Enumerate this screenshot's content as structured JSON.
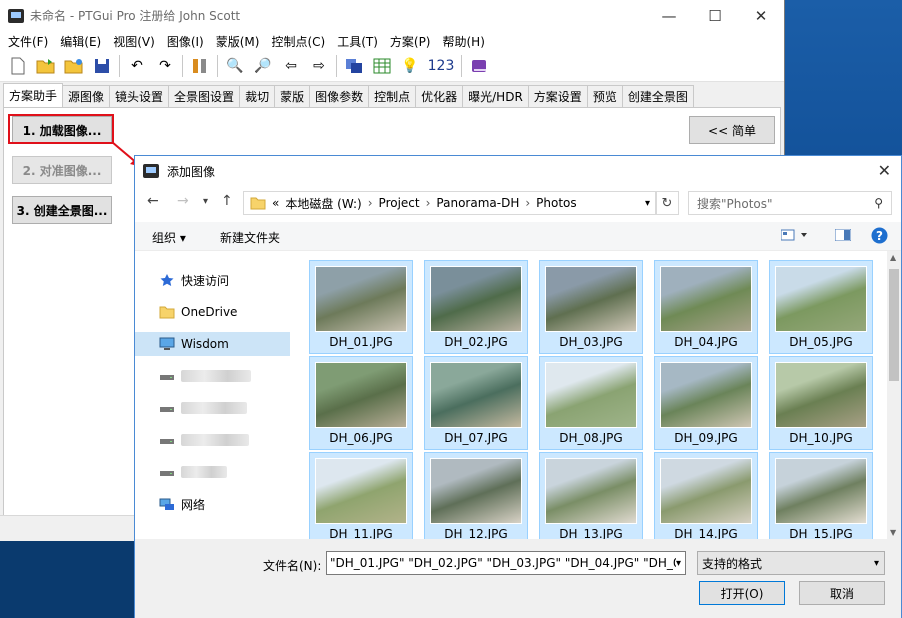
{
  "main_window": {
    "title": "未命名 - PTGui Pro 注册给 John Scott",
    "controls": {
      "minimize": "—",
      "maximize": "☐",
      "close": "✕"
    },
    "menu": [
      "文件(F)",
      "编辑(E)",
      "视图(V)",
      "图像(I)",
      "蒙版(M)",
      "控制点(C)",
      "工具(T)",
      "方案(P)",
      "帮助(H)"
    ],
    "toolbar_counter": "123",
    "tabs": [
      "方案助手",
      "源图像",
      "镜头设置",
      "全景图设置",
      "裁切",
      "蒙版",
      "图像参数",
      "控制点",
      "优化器",
      "曝光/HDR",
      "方案设置",
      "预览",
      "创建全景图"
    ],
    "active_tab": 0,
    "wizard": {
      "load_button": "1. 加载图像...",
      "align_button": "2. 对准图像...",
      "create_button": "3. 创建全景图...",
      "simple_button": "<< 简单"
    }
  },
  "dialog": {
    "title": "添加图像",
    "close": "✕",
    "address": {
      "prefix": "«",
      "parts": [
        "本地磁盘 (W:)",
        "Project",
        "Panorama-DH",
        "Photos"
      ]
    },
    "search_placeholder": "搜索\"Photos\"",
    "commands": {
      "organize": "组织 ▾",
      "new_folder": "新建文件夹"
    },
    "nav_items": [
      {
        "label": "快速访问",
        "icon": "star-icon"
      },
      {
        "label": "OneDrive",
        "icon": "folder-icon"
      },
      {
        "label": "Wisdom",
        "icon": "computer-icon"
      },
      {
        "label": "",
        "icon": "drive-icon"
      },
      {
        "label": "",
        "icon": "drive-icon"
      },
      {
        "label": "",
        "icon": "drive-icon"
      },
      {
        "label": "",
        "icon": "drive-icon"
      },
      {
        "label": "网络",
        "icon": "network-icon"
      }
    ],
    "files": [
      "DH_01.JPG",
      "DH_02.JPG",
      "DH_03.JPG",
      "DH_04.JPG",
      "DH_05.JPG",
      "DH_06.JPG",
      "DH_07.JPG",
      "DH_08.JPG",
      "DH_09.JPG",
      "DH_10.JPG",
      "DH_11.JPG",
      "DH_12.JPG",
      "DH_13.JPG",
      "DH_14.JPG",
      "DH_15.JPG"
    ],
    "filename_label": "文件名(N):",
    "filename_value": "\"DH_01.JPG\" \"DH_02.JPG\" \"DH_03.JPG\" \"DH_04.JPG\" \"DH_0",
    "filter_value": "支持的格式",
    "open_button": "打开(O)",
    "cancel_button": "取消"
  },
  "colors": {
    "selection": "#cce8ff",
    "highlight_frame": "#e0101a",
    "accent": "#0078d7"
  }
}
